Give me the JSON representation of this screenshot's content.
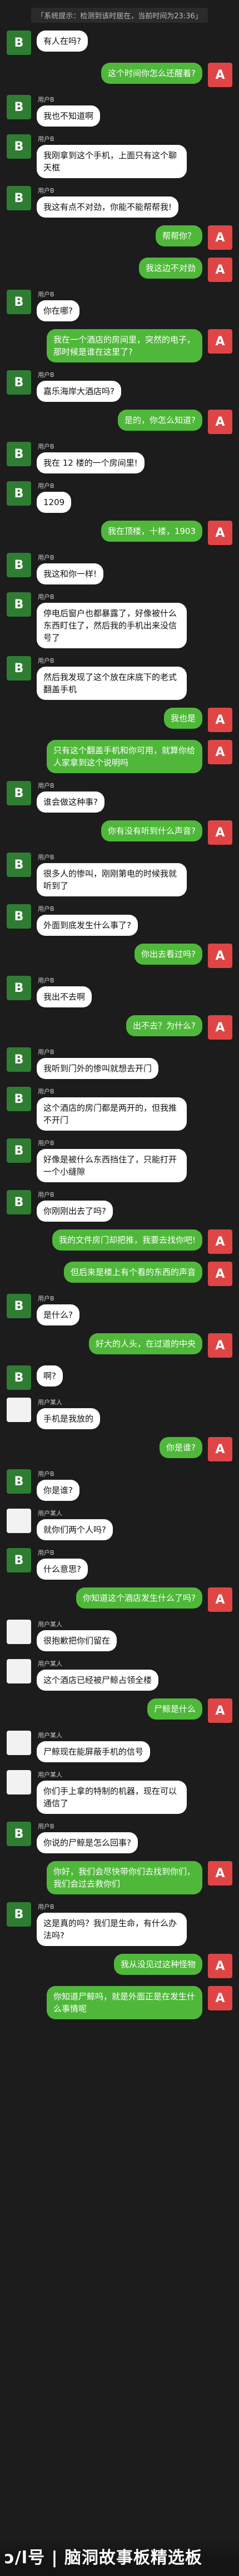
{
  "system_notice": "「系统提示：检测到该时居在，当前时间为23:36」",
  "watermark": "ɔ/l号 | 脑洞故事板精选板",
  "messages": [
    {
      "side": "left",
      "avatar": "B",
      "avatar_color": "green",
      "name": "",
      "text": "有人在吗?"
    },
    {
      "side": "right",
      "avatar": "A",
      "name": "",
      "text": "这个时间你怎么还醒着?"
    },
    {
      "side": "left",
      "avatar": "B",
      "avatar_color": "green",
      "name": "用户B",
      "text": "我也不知道啊"
    },
    {
      "side": "left",
      "avatar": "B",
      "avatar_color": "green",
      "name": "用户B",
      "text": "我刚拿到这个手机，上面只有这个聊天框"
    },
    {
      "side": "left",
      "avatar": "B",
      "avatar_color": "green",
      "name": "用户B",
      "text": "我这有点不对劲，你能不能帮帮我!"
    },
    {
      "side": "right",
      "avatar": "A",
      "name": "",
      "text": "帮帮你？"
    },
    {
      "side": "right",
      "avatar": "A",
      "name": "",
      "text": "我这边不对劲"
    },
    {
      "side": "left",
      "avatar": "B",
      "avatar_color": "green",
      "name": "用户B",
      "text": "你在哪?"
    },
    {
      "side": "right",
      "avatar": "A",
      "name": "",
      "text": "我在一个酒店的房间里，突然的电子，那时候是谁在这里了?"
    },
    {
      "side": "left",
      "avatar": "B",
      "avatar_color": "green",
      "name": "用户B",
      "text": "嘉乐海岸大酒店吗?"
    },
    {
      "side": "right",
      "avatar": "A",
      "name": "",
      "text": "是的，你怎么知道?"
    },
    {
      "side": "left",
      "avatar": "B",
      "avatar_color": "green",
      "name": "用户B",
      "text": "我在 12 楼的一个房间里!"
    },
    {
      "side": "left",
      "avatar": "B",
      "avatar_color": "green",
      "name": "用户B",
      "text": "1209"
    },
    {
      "side": "right",
      "avatar": "A",
      "name": "",
      "text": "我在顶楼，十楼，1903"
    },
    {
      "side": "left",
      "avatar": "B",
      "avatar_color": "green",
      "name": "用户B",
      "text": "我这和你一样!"
    },
    {
      "side": "left",
      "avatar": "B",
      "avatar_color": "green",
      "name": "用户B",
      "text": "停电后窗户也都暴露了，好像被什么东西盯住了，然后我的手机出来没信号了"
    },
    {
      "side": "left",
      "avatar": "B",
      "avatar_color": "green",
      "name": "用户B",
      "text": "然后我发现了这个放在床底下的老式翻盖手机"
    },
    {
      "side": "right",
      "avatar": "A",
      "name": "",
      "text": "我也是"
    },
    {
      "side": "right",
      "avatar": "A",
      "name": "",
      "text": "只有这个翻盖手机和你可用，就算你给人家拿到这个说明吗"
    },
    {
      "side": "left",
      "avatar": "B",
      "avatar_color": "green",
      "name": "用户B",
      "text": "谁会做这种事?"
    },
    {
      "side": "right",
      "avatar": "A",
      "name": "",
      "text": "你有没有听到什么声音?"
    },
    {
      "side": "left",
      "avatar": "B",
      "avatar_color": "green",
      "name": "用户B",
      "text": "很多人的惨叫，刚刚第电的时候我就听到了"
    },
    {
      "side": "left",
      "avatar": "B",
      "avatar_color": "green",
      "name": "用户B",
      "text": "外面到底发生什么事了?"
    },
    {
      "side": "right",
      "avatar": "A",
      "name": "",
      "text": "你出去看过吗?"
    },
    {
      "side": "left",
      "avatar": "B",
      "avatar_color": "green",
      "name": "用户B",
      "text": "我出不去啊"
    },
    {
      "side": "right",
      "avatar": "A",
      "name": "",
      "text": "出不去？为什么?"
    },
    {
      "side": "left",
      "avatar": "B",
      "avatar_color": "green",
      "name": "用户B",
      "text": "我听到门外的惨叫就想去开门"
    },
    {
      "side": "left",
      "avatar": "B",
      "avatar_color": "green",
      "name": "用户B",
      "text": "这个酒店的房门都是两开的，但我推不开门"
    },
    {
      "side": "left",
      "avatar": "B",
      "avatar_color": "green",
      "name": "用户B",
      "text": "好像是被什么东西挡住了，只能打开一个小缝隙"
    },
    {
      "side": "left",
      "avatar": "B",
      "avatar_color": "green",
      "name": "用户B",
      "text": "你刚刚出去了吗?"
    },
    {
      "side": "right",
      "avatar": "A",
      "name": "",
      "text": "我的文件房门却把推，我要去找你吧!"
    },
    {
      "side": "right",
      "avatar": "A",
      "name": "",
      "text": "但后来是楼上有个看的东西的声音"
    },
    {
      "side": "left",
      "avatar": "B",
      "avatar_color": "green",
      "name": "用户B",
      "text": "是什么?"
    },
    {
      "side": "right",
      "avatar": "A",
      "name": "",
      "text": "好大的人头，在过道的中央"
    },
    {
      "side": "left",
      "avatar": "B",
      "avatar_color": "green",
      "name": "",
      "text": "啊?"
    },
    {
      "side": "left",
      "avatar": "",
      "avatar_color": "white",
      "name": "用户某人",
      "text": "手机是我放的"
    },
    {
      "side": "right",
      "avatar": "A",
      "name": "",
      "text": "你是谁?"
    },
    {
      "side": "left",
      "avatar": "B",
      "avatar_color": "green",
      "name": "用户B",
      "text": "你是谁?"
    },
    {
      "side": "left",
      "avatar": "",
      "avatar_color": "white",
      "name": "用户某人",
      "text": "就你们两个人吗?"
    },
    {
      "side": "left",
      "avatar": "B",
      "avatar_color": "green",
      "name": "用户B",
      "text": "什么意思?"
    },
    {
      "side": "right",
      "avatar": "A",
      "name": "",
      "text": "你知道这个酒店发生什么了吗?"
    },
    {
      "side": "left",
      "avatar": "",
      "avatar_color": "white",
      "name": "用户某人",
      "text": "很抱歉把你们留在"
    },
    {
      "side": "left",
      "avatar": "",
      "avatar_color": "white",
      "name": "用户某人",
      "text": "这个酒店已经被尸鲸占领全楼"
    },
    {
      "side": "right",
      "avatar": "A",
      "name": "",
      "text": "尸鲸是什么"
    },
    {
      "side": "left",
      "avatar": "",
      "avatar_color": "white",
      "name": "用户某人",
      "text": "尸鲸现在能屏蔽手机的信号"
    },
    {
      "side": "left",
      "avatar": "",
      "avatar_color": "white",
      "name": "用户某人",
      "text": "你们手上拿的特制的机器，现在可以通信了"
    },
    {
      "side": "left",
      "avatar": "B",
      "avatar_color": "green",
      "name": "用户B",
      "text": "你说的尸鲸是怎么回事?"
    },
    {
      "side": "right",
      "avatar": "A",
      "name": "",
      "text": "你好，我们会尽快带你们去找到你们，我们会过去救你们"
    },
    {
      "side": "left",
      "avatar": "B",
      "avatar_color": "green",
      "name": "用户B",
      "text": "这是真的吗？我们是生命，有什么办法吗?"
    },
    {
      "side": "right",
      "avatar": "A",
      "name": "",
      "text": "我从没见过这种怪物"
    },
    {
      "side": "right",
      "avatar": "A",
      "name": "",
      "text": "你知道尸鲸吗，就是外面正是在发生什么事情呢"
    }
  ]
}
